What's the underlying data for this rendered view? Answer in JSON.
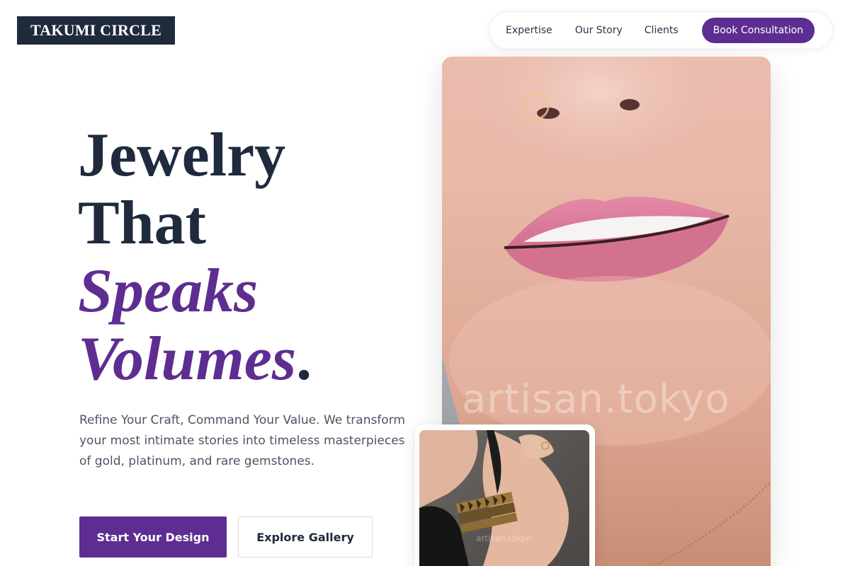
{
  "brand": {
    "logo": "TAKUMI CIRCLE"
  },
  "nav": {
    "links": [
      "Expertise",
      "Our Story",
      "Clients"
    ],
    "cta": "Book Consultation"
  },
  "hero": {
    "title_line1": "Jewelry",
    "title_line2": "That",
    "title_line3": "Speaks",
    "title_line4": "Volumes",
    "title_dot": ".",
    "subtitle": "Refine Your Craft, Command Your Value. We transform your most intimate stories into timeless masterpieces of gold, platinum, and rare gemstones.",
    "primary_button": "Start Your Design",
    "secondary_button": "Explore Gallery"
  },
  "media": {
    "main_watermark": "artisan.tokyo",
    "inset_watermark": "artisan.tokyo"
  },
  "colors": {
    "brand_navy": "#1f2a3d",
    "accent_purple": "#5e2d91",
    "text_gray": "#4b5563"
  }
}
